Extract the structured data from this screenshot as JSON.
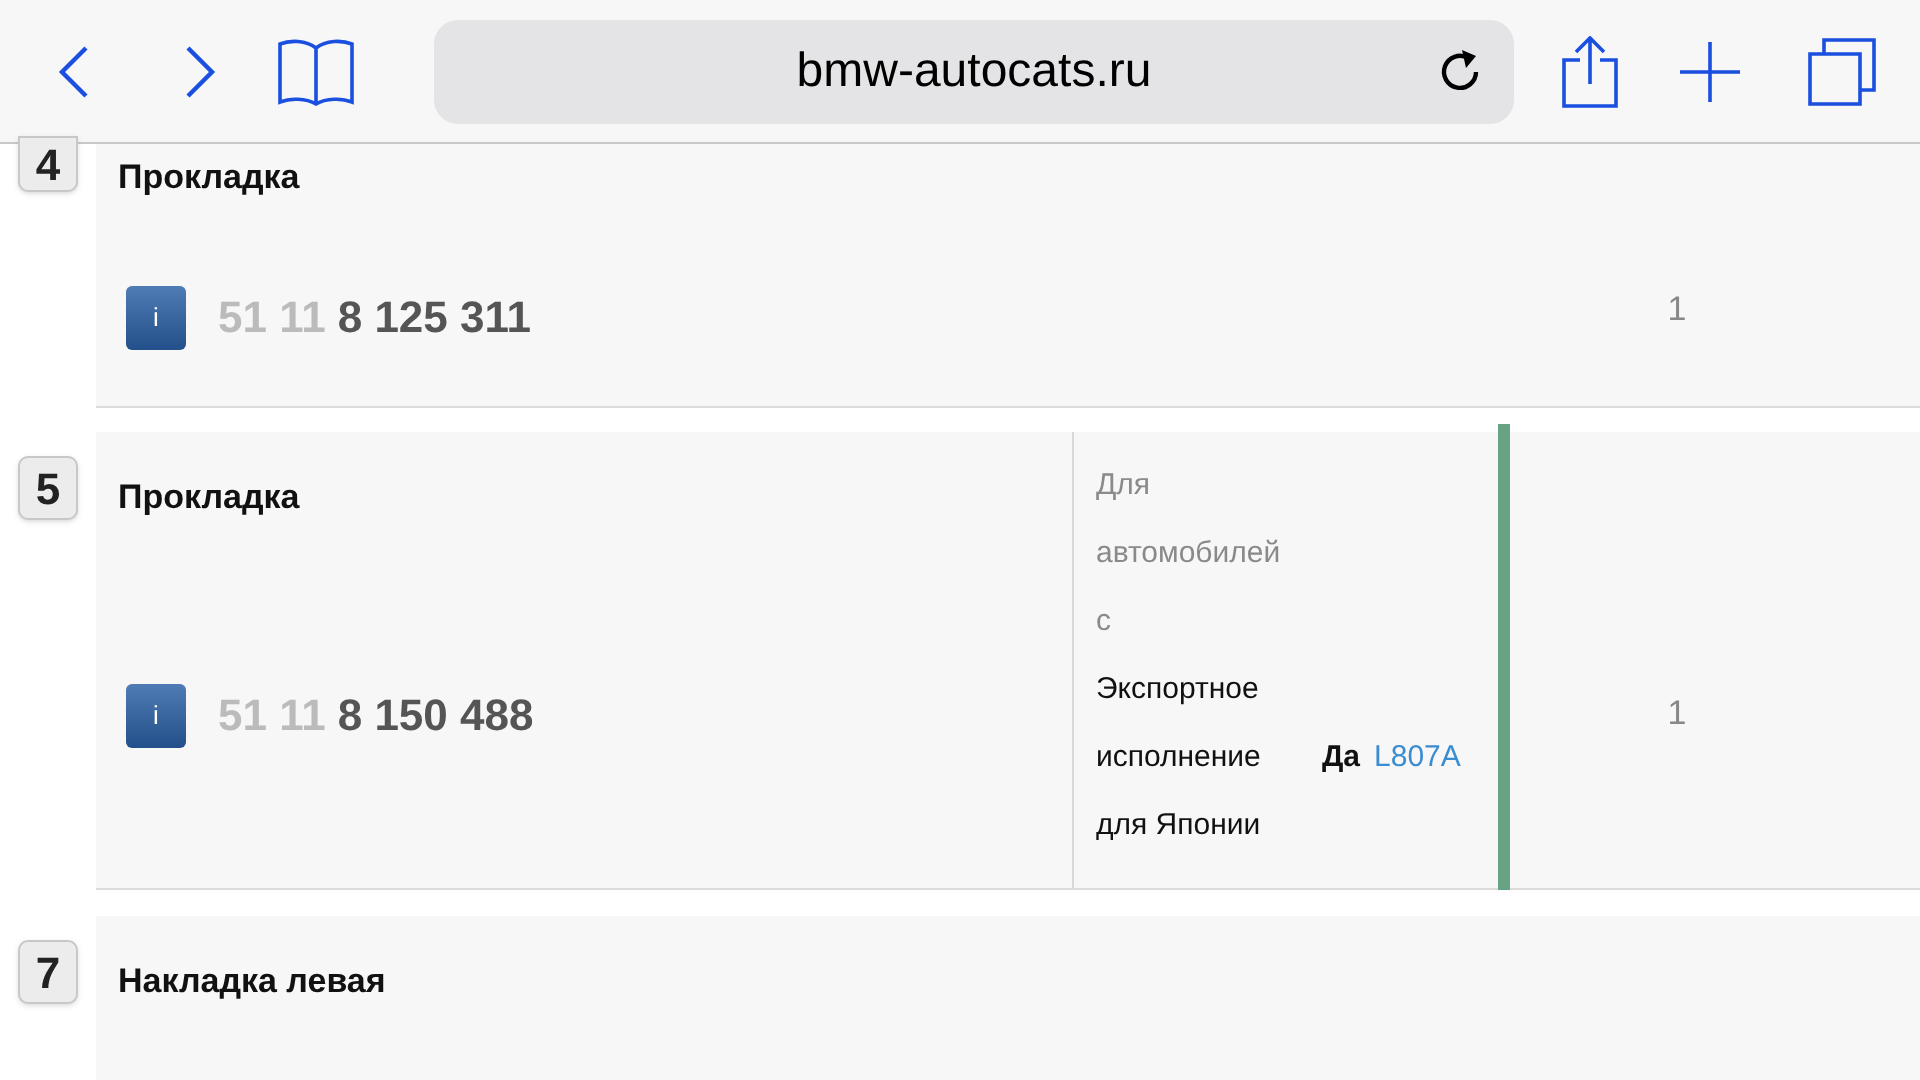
{
  "browser": {
    "address": "bmw-autocats.ru"
  },
  "rows": [
    {
      "number": "4",
      "name": "Прокладка",
      "info": "i",
      "part_prefix": "51 11",
      "part_main": "8 125 311",
      "quantity": "1"
    },
    {
      "number": "5",
      "name": "Прокладка",
      "info": "i",
      "part_prefix": "51 11",
      "part_main": "8 150 488",
      "quantity": "1",
      "note": {
        "intro": "Для автомобилей с",
        "condition": "Экспортное исполнение для Японии",
        "value": "Да",
        "code": "L807A"
      }
    },
    {
      "number": "7",
      "name": "Накладка левая"
    }
  ]
}
